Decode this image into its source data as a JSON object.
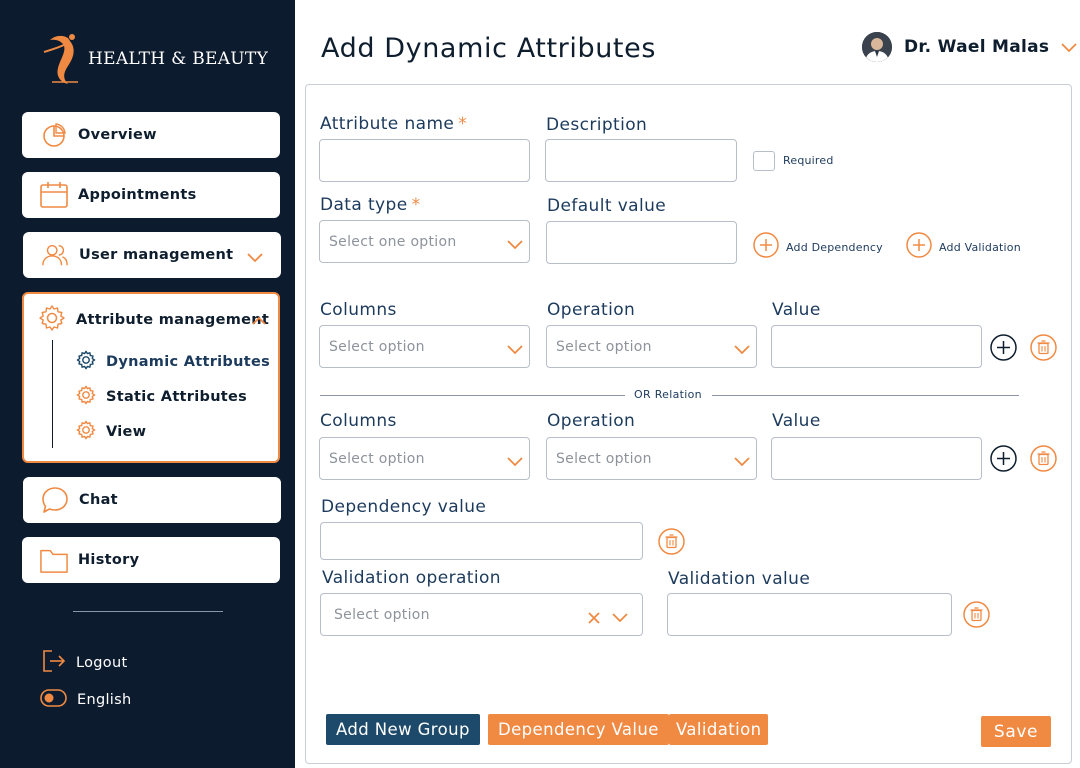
{
  "brand": {
    "name": "HEALTH & BEAUTY"
  },
  "sidebar": {
    "items": [
      {
        "label": "Overview"
      },
      {
        "label": "Appointments"
      },
      {
        "label": "User management"
      },
      {
        "label": "Attribute management"
      },
      {
        "label": "Chat"
      },
      {
        "label": "History"
      }
    ],
    "sub_items": [
      {
        "label": "Dynamic Attributes",
        "active": true
      },
      {
        "label": "Static Attributes"
      },
      {
        "label": "View"
      }
    ],
    "footer": {
      "logout": "Logout",
      "language": "English"
    }
  },
  "header": {
    "title": "Add Dynamic Attributes",
    "user_name": "Dr. Wael Malas"
  },
  "form": {
    "attribute_name": {
      "label": "Attribute name",
      "required_mark": "*",
      "value": ""
    },
    "description": {
      "label": "Description",
      "value": ""
    },
    "required_checkbox": {
      "label": "Required",
      "checked": false
    },
    "data_type": {
      "label": "Data type",
      "required_mark": "*",
      "placeholder": "Select one option"
    },
    "default_value": {
      "label": "Default value",
      "value": ""
    },
    "add_dependency": "Add Dependency",
    "add_validation": "Add Validation",
    "dependency_groups": [
      {
        "columns_label": "Columns",
        "columns_placeholder": "Select option",
        "operation_label": "Operation",
        "operation_placeholder": "Select option",
        "value_label": "Value",
        "value": ""
      },
      {
        "columns_label": "Columns",
        "columns_placeholder": "Select option",
        "operation_label": "Operation",
        "operation_placeholder": "Select option",
        "value_label": "Value",
        "value": ""
      }
    ],
    "or_relation": "OR Relation",
    "dependency_value": {
      "label": "Dependency value",
      "value": ""
    },
    "validation_operation": {
      "label": "Validation operation",
      "placeholder": "Select option"
    },
    "validation_value": {
      "label": "Validation value",
      "value": ""
    }
  },
  "footer_buttons": {
    "add_new_group": "Add New Group",
    "dependency_value": "Dependency Value",
    "validation": "Validation",
    "save": "Save"
  },
  "colors": {
    "sidebar_bg": "#0d1b2e",
    "accent": "#f08a43",
    "navy_button": "#1d4a6b",
    "text_dark": "#1c3a5c"
  }
}
